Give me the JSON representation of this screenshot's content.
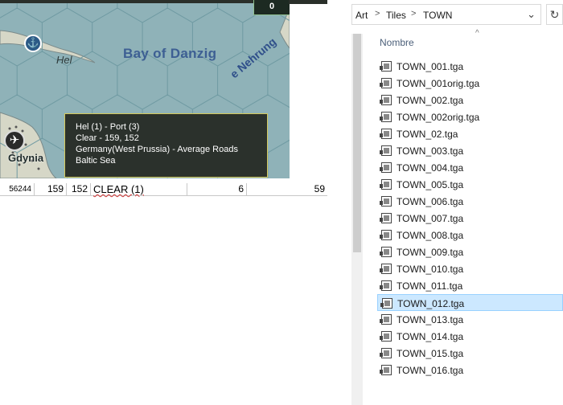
{
  "map": {
    "bay_label": "Bay of Danzig",
    "hel_label": "Hel",
    "gdynia_label": "Gdynia",
    "nehrung_label": "e Nehrung",
    "counter_value": "0",
    "port_icon_glyph": "⚓",
    "airfield_icon_glyph": "✈",
    "colors": {
      "sea": "#8fb2b8",
      "land": "#d6d7c7",
      "hex_line": "#6f9aa2"
    }
  },
  "tooltip": {
    "line1": "Hel (1) - Port (3)",
    "line2": "Clear - 159, 152",
    "line3": "Germany(West Prussia) - Average Roads",
    "line4": "Baltic Sea"
  },
  "grid": {
    "row": {
      "id": "56244",
      "x": "159",
      "y": "152",
      "terrain": "CLEAR (1)",
      "val1": "6",
      "val2": "59"
    }
  },
  "explorer": {
    "breadcrumbs": [
      "Art",
      "Tiles",
      "TOWN"
    ],
    "breadcrumb_sep": ">",
    "dropdown_glyph": "⌄",
    "refresh_glyph": "↻",
    "column_header": "Nombre",
    "sort_glyph": "^",
    "files": [
      "TOWN_001.tga",
      "TOWN_001orig.tga",
      "TOWN_002.tga",
      "TOWN_002orig.tga",
      "TOWN_02.tga",
      "TOWN_003.tga",
      "TOWN_004.tga",
      "TOWN_005.tga",
      "TOWN_006.tga",
      "TOWN_007.tga",
      "TOWN_008.tga",
      "TOWN_009.tga",
      "TOWN_010.tga",
      "TOWN_011.tga",
      "TOWN_012.tga",
      "TOWN_013.tga",
      "TOWN_014.tga",
      "TOWN_015.tga",
      "TOWN_016.tga"
    ],
    "selected_file": "TOWN_012.tga"
  }
}
